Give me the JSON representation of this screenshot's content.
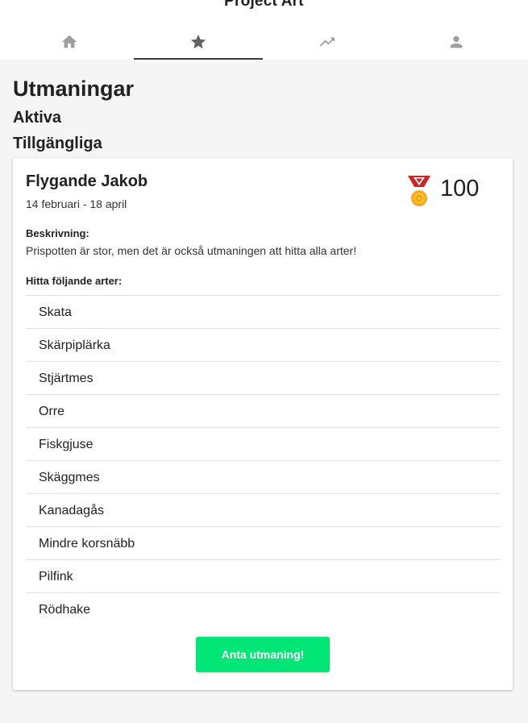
{
  "header": {
    "app_title": "Project Art",
    "tabs": [
      {
        "icon": "home-icon",
        "active": false
      },
      {
        "icon": "star-icon",
        "active": true
      },
      {
        "icon": "trending-up-icon",
        "active": false
      },
      {
        "icon": "person-icon",
        "active": false
      }
    ]
  },
  "main": {
    "title": "Utmaningar",
    "sections": {
      "active": "Aktiva",
      "available": "Tillgängliga"
    },
    "challenge": {
      "name": "Flygande Jakob",
      "dates": "14 februari - 18 april",
      "reward_icon": "medal-icon",
      "points": "100",
      "description_label": "Beskrivning:",
      "description": "Prispotten är stor, men det är också utmaningen att hitta alla arter!",
      "species_label": "Hitta följande arter:",
      "species": [
        "Skata",
        "Skärpiplärka",
        "Stjärtmes",
        "Orre",
        "Fiskgjuse",
        "Skäggmes",
        "Kanadagås",
        "Mindre korsnäbb",
        "Pilfink",
        "Rödhake"
      ],
      "accept_label": "Anta utmaning!"
    }
  },
  "colors": {
    "accent": "#00e676",
    "tab_active": "#3a3a3a",
    "tab_inactive": "#9e9e9e"
  }
}
